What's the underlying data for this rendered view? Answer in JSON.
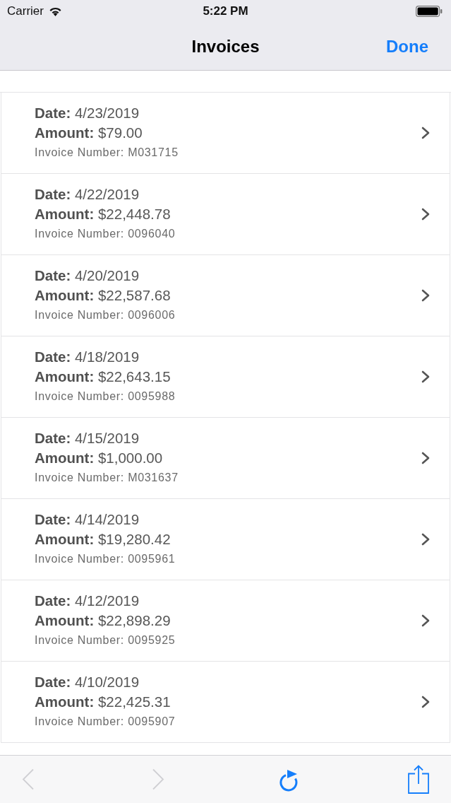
{
  "status_bar": {
    "carrier": "Carrier",
    "time": "5:22 PM"
  },
  "nav_bar": {
    "title": "Invoices",
    "done": "Done"
  },
  "invoices": [
    {
      "date": "**Date:** 4/23/2019",
      "amount": "**Amount:** $79.00",
      "invoice_number": "Invoice Number: M031715"
    },
    {
      "date": "**Date:** 4/22/2019",
      "amount": "**Amount:** $22,448.78",
      "invoice_number": "Invoice Number: 0096040"
    },
    {
      "date": "**Date:** 4/20/2019",
      "amount": "**Amount:** $22,587.68",
      "invoice_number": "Invoice Number: 0096006"
    },
    {
      "date": "**Date:** 4/18/2019",
      "amount": "**Amount:** $22,643.15",
      "invoice_number": "Invoice Number: 0095988"
    },
    {
      "date": "**Date:** 4/15/2019",
      "amount": "**Amount:** $1,000.00",
      "invoice_number": "Invoice Number: M031637"
    },
    {
      "date": "**Date:** 4/14/2019",
      "amount": "**Amount:** $19,280.42",
      "invoice_number": "Invoice Number: 0095961"
    },
    {
      "date": "**Date:** 4/12/2019",
      "amount": "**Amount:** $22,898.29",
      "invoice_number": "Invoice Number: 0095925"
    },
    {
      "date": "**Date:** 4/10/2019",
      "amount": "**Amount:** $22,425.31",
      "invoice_number": "Invoice Number: 0095907"
    }
  ],
  "toolbar": [
    {
      "kind": "back",
      "disabled": true
    },
    {
      "kind": "forward",
      "disabled": true
    },
    {
      "kind": "refresh",
      "disabled": false
    },
    {
      "kind": "share",
      "disabled": false
    }
  ]
}
